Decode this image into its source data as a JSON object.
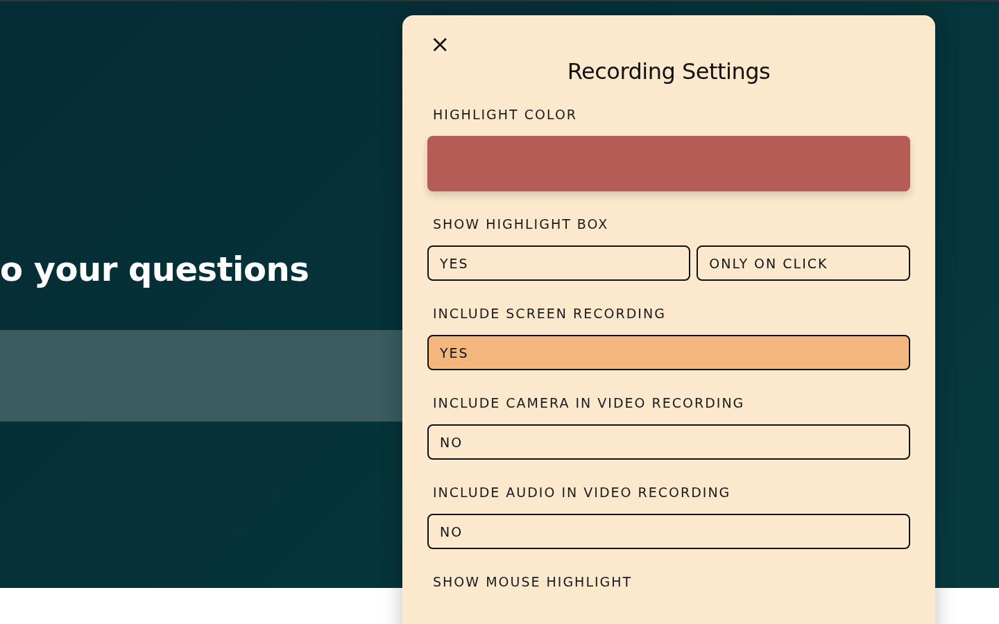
{
  "hero": {
    "heading": "o your questions"
  },
  "dialog": {
    "title": "Recording Settings",
    "close": "×",
    "settings": [
      {
        "kind": "color",
        "label": "HIGHLIGHT COLOR",
        "color": "#b55c57"
      },
      {
        "kind": "choice",
        "label": "SHOW HIGHLIGHT BOX",
        "options": [
          {
            "label": "YES",
            "selected": false
          },
          {
            "label": "ONLY ON CLICK",
            "selected": false
          }
        ]
      },
      {
        "kind": "choice",
        "label": "INCLUDE SCREEN RECORDING",
        "options": [
          {
            "label": "YES",
            "selected": true
          }
        ]
      },
      {
        "kind": "choice",
        "label": "INCLUDE CAMERA IN VIDEO RECORDING",
        "options": [
          {
            "label": "NO",
            "selected": false
          }
        ]
      },
      {
        "kind": "choice",
        "label": "INCLUDE AUDIO IN VIDEO RECORDING",
        "options": [
          {
            "label": "NO",
            "selected": false
          }
        ]
      },
      {
        "kind": "choice",
        "label": "SHOW MOUSE HIGHLIGHT"
      }
    ]
  }
}
